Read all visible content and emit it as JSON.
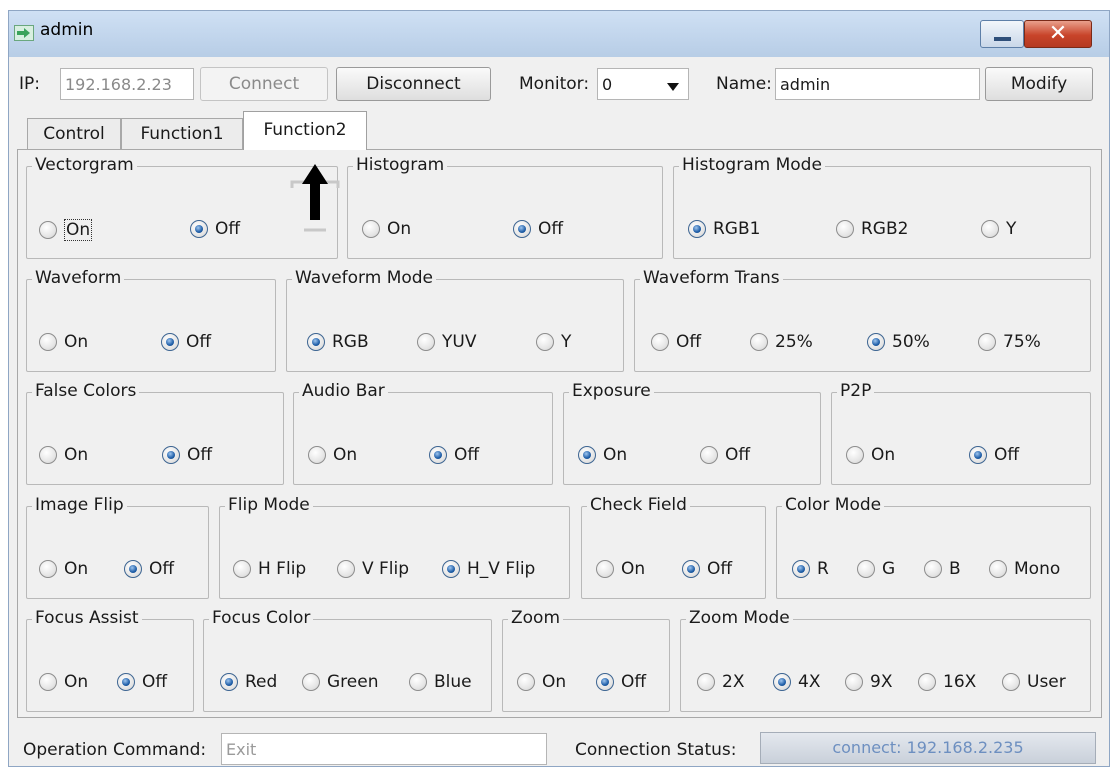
{
  "window": {
    "title": "admin"
  },
  "toolbar": {
    "ip_label": "IP:",
    "ip_value": "192.168.2.23",
    "connect_label": "Connect",
    "disconnect_label": "Disconnect",
    "monitor_label": "Monitor:",
    "monitor_value": "0",
    "name_label": "Name:",
    "name_value": "admin",
    "modify_label": "Modify"
  },
  "tabs": [
    {
      "label": "Control",
      "active": false
    },
    {
      "label": "Function1",
      "active": false
    },
    {
      "label": "Function2",
      "active": true
    }
  ],
  "groups": {
    "vectorgram": {
      "title": "Vectorgram",
      "options": [
        "On",
        "Off"
      ],
      "selected": "Off"
    },
    "histogram": {
      "title": "Histogram",
      "options": [
        "On",
        "Off"
      ],
      "selected": "Off"
    },
    "histogram_mode": {
      "title": "Histogram Mode",
      "options": [
        "RGB1",
        "RGB2",
        "Y"
      ],
      "selected": "RGB1"
    },
    "waveform": {
      "title": "Waveform",
      "options": [
        "On",
        "Off"
      ],
      "selected": "Off"
    },
    "waveform_mode": {
      "title": "Waveform Mode",
      "options": [
        "RGB",
        "YUV",
        "Y"
      ],
      "selected": "RGB"
    },
    "waveform_trans": {
      "title": "Waveform Trans",
      "options": [
        "Off",
        "25%",
        "50%",
        "75%"
      ],
      "selected": "50%"
    },
    "false_colors": {
      "title": "False Colors",
      "options": [
        "On",
        "Off"
      ],
      "selected": "Off"
    },
    "audio_bar": {
      "title": "Audio Bar",
      "options": [
        "On",
        "Off"
      ],
      "selected": "Off"
    },
    "exposure": {
      "title": "Exposure",
      "options": [
        "On",
        "Off"
      ],
      "selected": "On"
    },
    "p2p": {
      "title": "P2P",
      "options": [
        "On",
        "Off"
      ],
      "selected": "Off"
    },
    "image_flip": {
      "title": "Image Flip",
      "options": [
        "On",
        "Off"
      ],
      "selected": "Off"
    },
    "flip_mode": {
      "title": "Flip Mode",
      "options": [
        "H Flip",
        "V Flip",
        "H_V Flip"
      ],
      "selected": "H_V Flip"
    },
    "check_field": {
      "title": "Check Field",
      "options": [
        "On",
        "Off"
      ],
      "selected": "Off"
    },
    "color_mode": {
      "title": "Color Mode",
      "options": [
        "R",
        "G",
        "B",
        "Mono"
      ],
      "selected": "R"
    },
    "focus_assist": {
      "title": "Focus Assist",
      "options": [
        "On",
        "Off"
      ],
      "selected": "Off"
    },
    "focus_color": {
      "title": "Focus Color",
      "options": [
        "Red",
        "Green",
        "Blue"
      ],
      "selected": "Red"
    },
    "zoom": {
      "title": "Zoom",
      "options": [
        "On",
        "Off"
      ],
      "selected": "Off"
    },
    "zoom_mode": {
      "title": "Zoom Mode",
      "options": [
        "2X",
        "4X",
        "9X",
        "16X",
        "User"
      ],
      "selected": "4X"
    }
  },
  "status": {
    "command_label": "Operation Command:",
    "command_value": "Exit",
    "connection_label": "Connection Status:",
    "connection_value": "connect: 192.168.2.235"
  },
  "icons": {
    "app": "arrow-right-icon",
    "minimize": "minimize-icon",
    "close": "close-icon",
    "dropdown": "triangle-down-icon",
    "annotation": "up-arrow-icon"
  },
  "colors": {
    "radio_checked": "#1f5ea8",
    "close_button": "#c8442a",
    "connection_text": "#6d8fc0"
  }
}
